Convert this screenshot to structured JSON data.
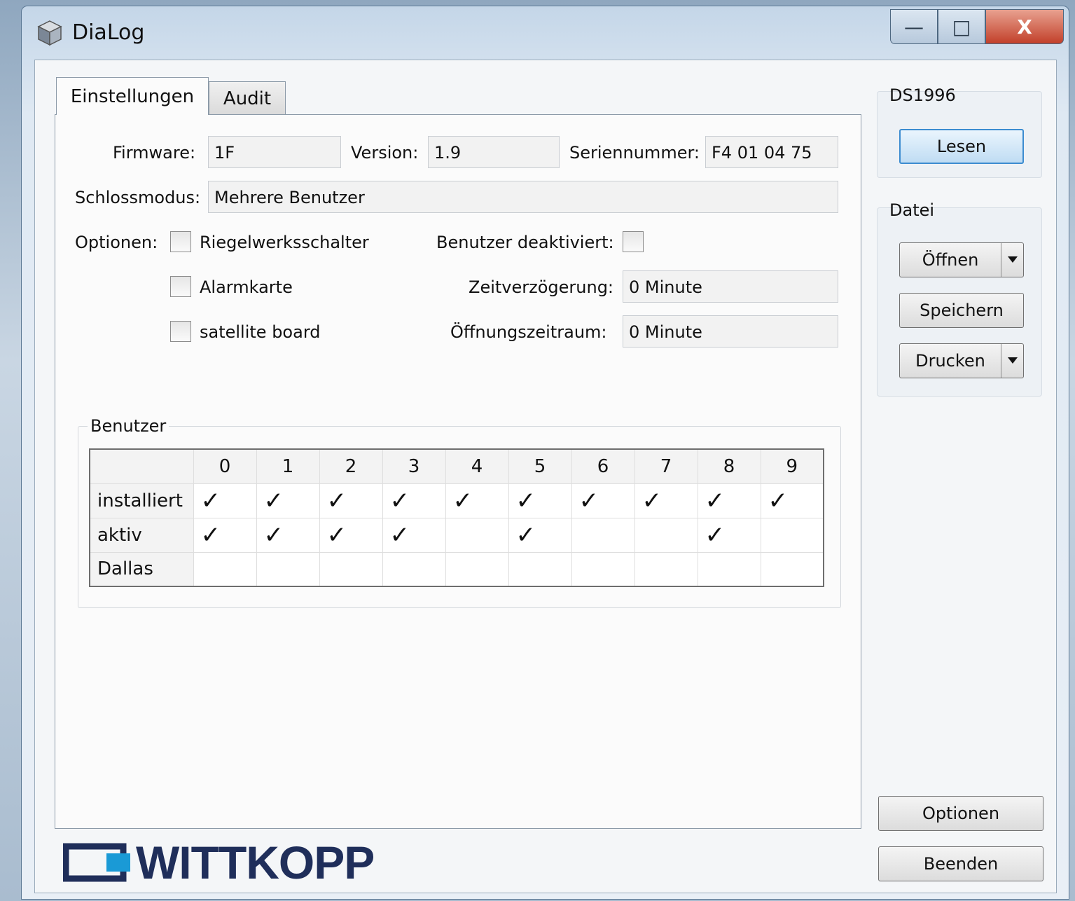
{
  "window": {
    "title": "DiaLog",
    "controls": {
      "minimize": "—",
      "maximize": "□",
      "close": "X"
    }
  },
  "tabs": [
    {
      "label": "Einstellungen",
      "active": true
    },
    {
      "label": "Audit",
      "active": false
    }
  ],
  "settings": {
    "firmware_label": "Firmware:",
    "firmware_value": "1F",
    "version_label": "Version:",
    "version_value": "1.9",
    "serial_label": "Seriennummer:",
    "serial_value": "F4 01 04 75",
    "mode_label": "Schlossmodus:",
    "mode_value": "Mehrere Benutzer",
    "options_label": "Optionen:",
    "option_riegel": "Riegelwerksschalter",
    "option_alarm": "Alarmkarte",
    "option_satellite": "satellite board",
    "user_disabled_label": "Benutzer deaktiviert:",
    "delay_label": "Zeitverzögerung:",
    "delay_value": "0 Minute",
    "window_label": "Öffnungszeitraum:",
    "window_value": "0 Minute"
  },
  "users": {
    "group_title": "Benutzer",
    "columns": [
      "0",
      "1",
      "2",
      "3",
      "4",
      "5",
      "6",
      "7",
      "8",
      "9"
    ],
    "rows": [
      {
        "label": "installiert",
        "cells": [
          "✓",
          "✓",
          "✓",
          "✓",
          "✓",
          "✓",
          "✓",
          "✓",
          "✓",
          "✓"
        ]
      },
      {
        "label": "aktiv",
        "cells": [
          "✓",
          "✓",
          "✓",
          "✓",
          "",
          "✓",
          "",
          "",
          "✓",
          ""
        ]
      },
      {
        "label": "Dallas",
        "cells": [
          "",
          "",
          "",
          "",
          "",
          "",
          "",
          "",
          "",
          ""
        ]
      }
    ]
  },
  "sidebar": {
    "device_title": "DS1996",
    "read_button": "Lesen",
    "file_title": "Datei",
    "open_button": "Öffnen",
    "save_button": "Speichern",
    "print_button": "Drucken",
    "options_button": "Optionen",
    "exit_button": "Beenden"
  },
  "logo": {
    "text": "WITTKOPP",
    "color": "#1f2e5a"
  }
}
